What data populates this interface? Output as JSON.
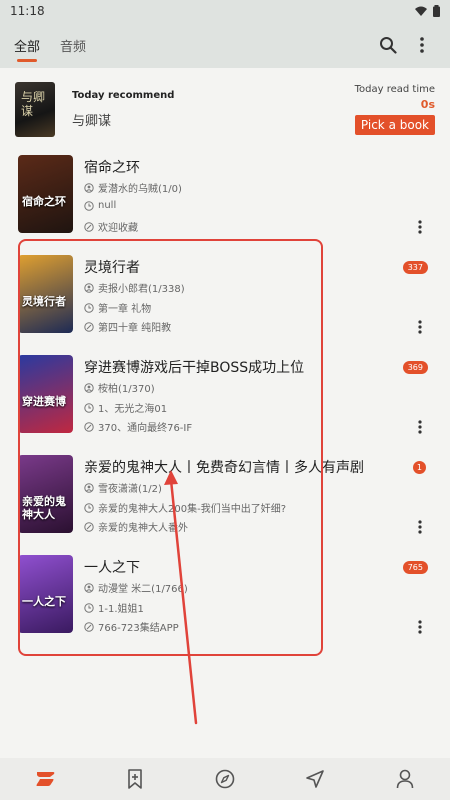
{
  "status": {
    "time": "11:18"
  },
  "tabs": [
    {
      "label": "全部",
      "active": true
    },
    {
      "label": "音频",
      "active": false
    }
  ],
  "toolbar": {
    "search_icon": "search-icon",
    "menu_icon": "more-vert-icon"
  },
  "recommend": {
    "label": "Today recommend",
    "title": "与卿谋",
    "cover_text": "与卿谋",
    "read_time_label": "Today read time",
    "read_time_value": "0s",
    "pick_button": "Pick a book"
  },
  "books": [
    {
      "title": "宿命之环",
      "author": "爱潜水的乌贼(1/0)",
      "latest": "null",
      "last_read": "欢迎收藏",
      "badge": "",
      "cover_text": "宿命之环",
      "cover_colors": [
        "#5b2a18",
        "#1f1410"
      ]
    },
    {
      "title": "灵境行者",
      "author": "卖报小郎君(1/338)",
      "latest": "第一章 礼物",
      "last_read": "第四十章 纯阳教",
      "badge": "337",
      "cover_text": "灵境行者",
      "cover_colors": [
        "#e0a030",
        "#1d2a55"
      ]
    },
    {
      "title": "穿进赛博游戏后干掉BOSS成功上位",
      "author": "桉柏(1/370)",
      "latest": "1、无光之海01",
      "last_read": "370、通向最终76-IF",
      "badge": "369",
      "cover_text": "穿进赛博",
      "cover_colors": [
        "#2a3aa0",
        "#c02840"
      ]
    },
    {
      "title": "亲爱的鬼神大人丨免费奇幻言情丨多人有声剧",
      "author": "雪夜潇潇(1/2)",
      "latest": "亲爱的鬼神大人200集-我们当中出了奸细?",
      "last_read": "亲爱的鬼神大人番外",
      "badge": "1",
      "cover_text": "亲爱的鬼神大人",
      "cover_colors": [
        "#7a3a8a",
        "#2a1030"
      ]
    },
    {
      "title": "一人之下",
      "author": "动漫堂 米二(1/766)",
      "latest": "1-1.姐姐1",
      "last_read": "766-723集结APP",
      "badge": "765",
      "cover_text": "一人之下",
      "cover_colors": [
        "#9050d0",
        "#3a1a60"
      ]
    }
  ],
  "bottom_nav": [
    {
      "name": "bookshelf-icon",
      "active": true
    },
    {
      "name": "bookmark-add-icon",
      "active": false
    },
    {
      "name": "compass-icon",
      "active": false
    },
    {
      "name": "navigation-icon",
      "active": false
    },
    {
      "name": "profile-icon",
      "active": false
    }
  ],
  "colors": {
    "accent": "#e3502a",
    "annotation": "#e0433a"
  }
}
